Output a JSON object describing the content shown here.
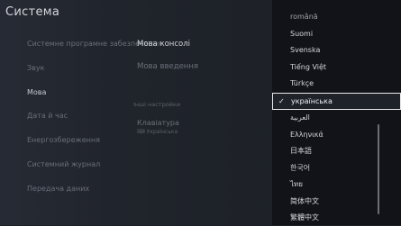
{
  "screen_title": "Система",
  "sidebar": {
    "items": [
      {
        "label": "Системне програмне забезпечення",
        "state": "dim"
      },
      {
        "label": "Звук",
        "state": "dim"
      },
      {
        "label": "Мова",
        "state": "active"
      },
      {
        "label": "Дата й час",
        "state": "dim"
      },
      {
        "label": "Енергозбереження",
        "state": "dim"
      },
      {
        "label": "Системний журнал",
        "state": "dim"
      },
      {
        "label": "Передача даних",
        "state": "dim"
      }
    ]
  },
  "main": {
    "console_language": "Мова консолі",
    "input_language": "Мова введення",
    "section_header": "Інші настройки",
    "keyboard_title": "Клавіатура",
    "keyboard_sub": "Українська"
  },
  "dropdown": {
    "languages": [
      "română",
      "Suomi",
      "Svenska",
      "Tiếng Việt",
      "Türkçe",
      "українська",
      "العربية",
      "Ελληνικά",
      "日本語",
      "한국어",
      "ไทย",
      "简体中文",
      "繁體中文"
    ],
    "selected": "українська",
    "check_icon_glyph": "✓"
  },
  "colors": {
    "background": "#1d2027",
    "dropdown_bg": "#111318",
    "selection_border": "#e8e9eb"
  }
}
